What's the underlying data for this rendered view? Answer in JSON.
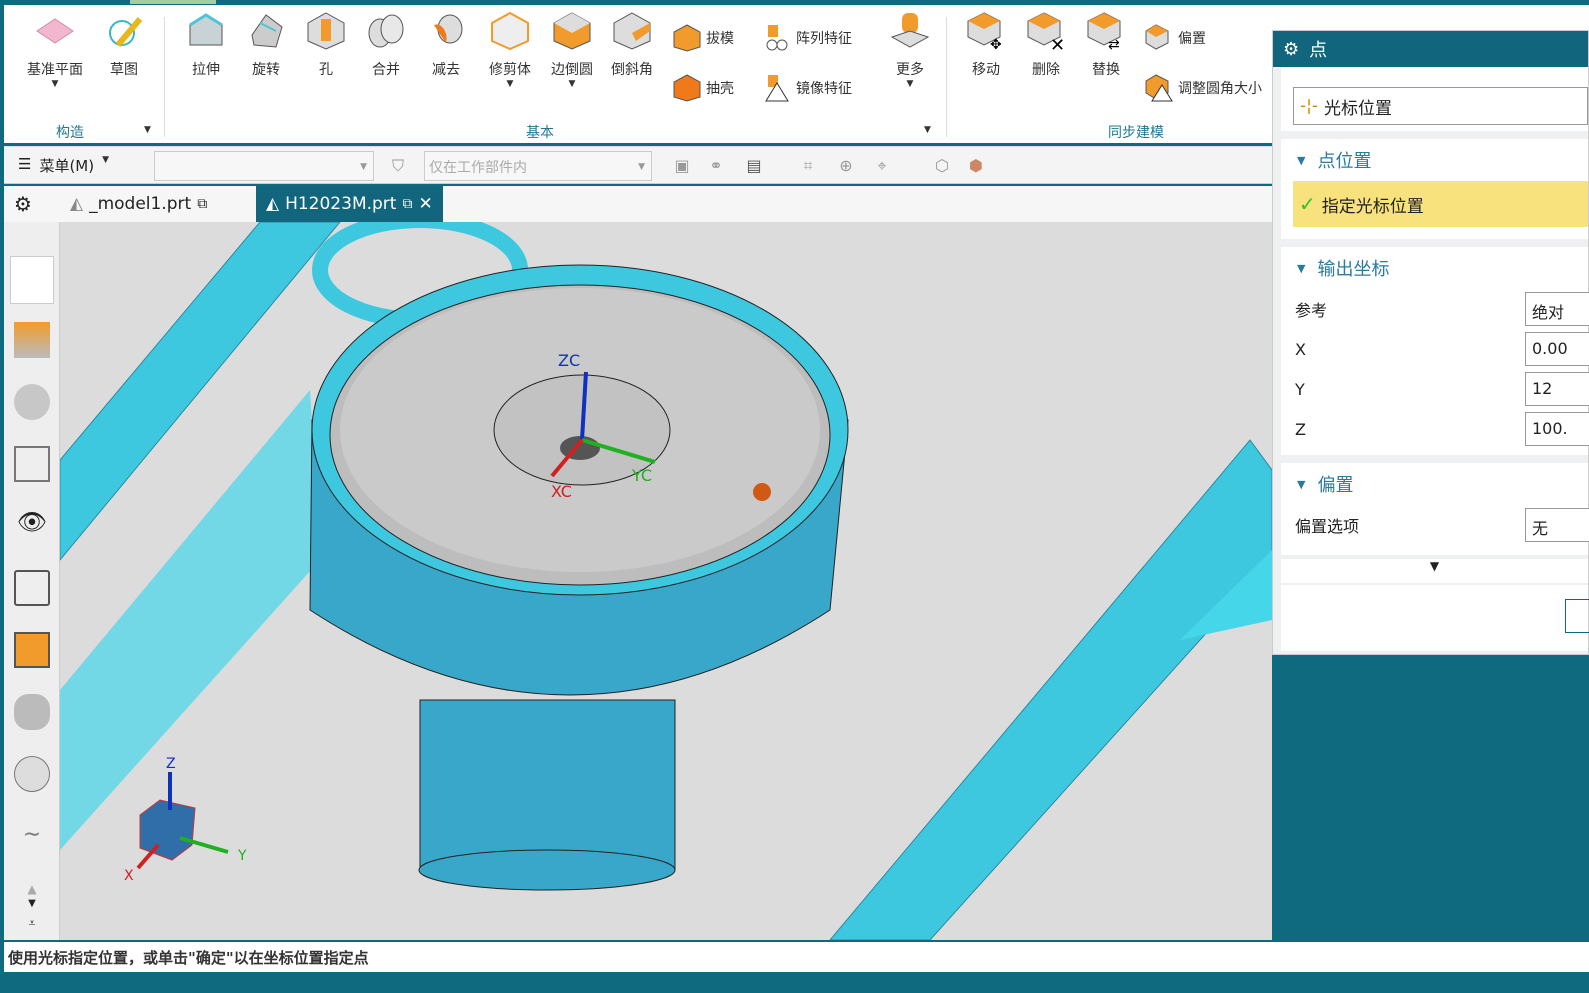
{
  "ribbon": {
    "construct": {
      "group": "构造",
      "items": [
        "基准平面",
        "草图"
      ]
    },
    "basic": {
      "group": "基本",
      "items": [
        "拉伸",
        "旋转",
        "孔",
        "合并",
        "减去",
        "修剪体",
        "边倒圆",
        "倒斜角"
      ],
      "small": [
        "拔模",
        "阵列特征",
        "抽壳",
        "镜像特征"
      ],
      "more": "更多"
    },
    "sync": {
      "group": "同步建模",
      "items": [
        "移动",
        "删除",
        "替换"
      ],
      "small": [
        "偏置",
        "调整圆角大小"
      ]
    }
  },
  "toolbar": {
    "menu": "菜单(M)",
    "filter_placeholder": "",
    "scope": "仅在工作部件内"
  },
  "tabs": [
    {
      "label": "_model1.prt",
      "active": false
    },
    {
      "label": "H12023M.prt",
      "active": true
    }
  ],
  "viewport": {
    "wcs": {
      "z": "ZC",
      "x": "XC",
      "y": "YC"
    },
    "triad": {
      "z": "Z",
      "x": "X",
      "y": "Y"
    },
    "colors": {
      "tube": "#3ec8e0",
      "model": "#38a7c9",
      "face": "#c8c8c8"
    }
  },
  "dialog": {
    "title": "点",
    "type_value": "光标位置",
    "point_location": {
      "title": "点位置",
      "selected": "指定光标位置"
    },
    "output": {
      "title": "输出坐标",
      "ref_label": "参考",
      "ref_value": "绝对",
      "x_label": "X",
      "x": "0.00",
      "y_label": "Y",
      "y": "12",
      "z_label": "Z",
      "z": "100."
    },
    "offset": {
      "title": "偏置",
      "option_label": "偏置选项",
      "option_value": "无"
    }
  },
  "status": "使用光标指定位置，或单击\"确定\"以在坐标位置指定点"
}
